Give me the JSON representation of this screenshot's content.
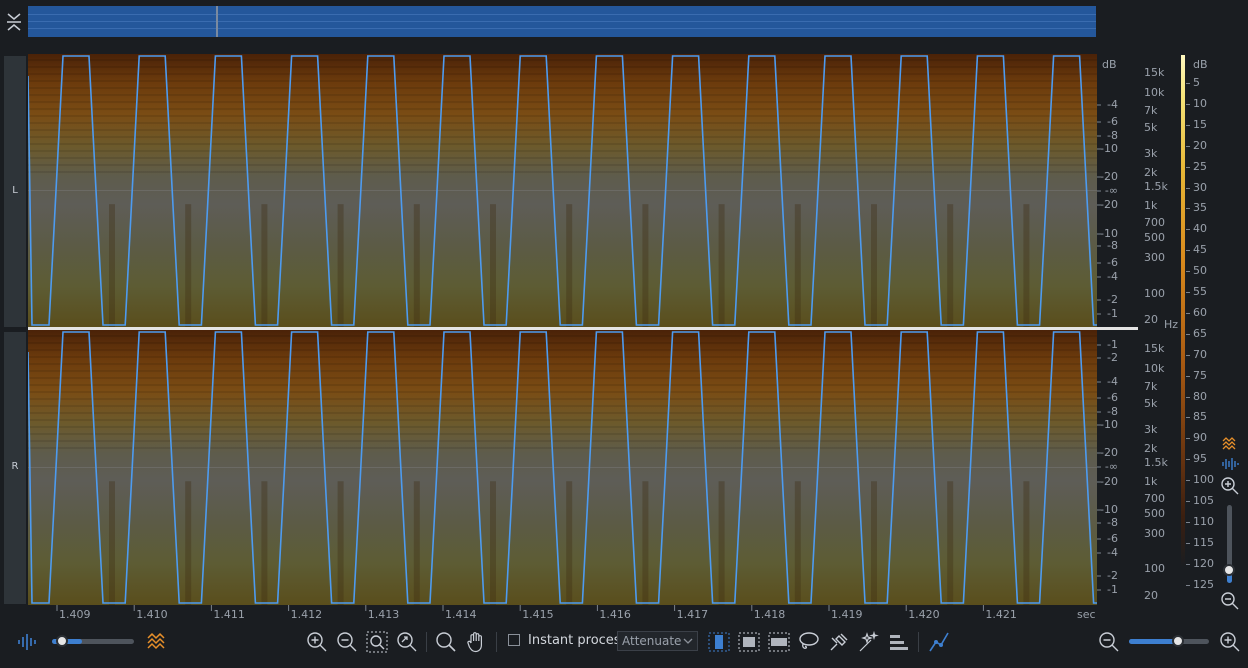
{
  "channels": {
    "left_label": "L",
    "right_label": "R"
  },
  "amplitude_scale": {
    "unit": "dB",
    "left_labels": [
      "-4",
      "-6",
      "-8",
      "-10",
      "-20",
      "-∞",
      "-20",
      "-10",
      "-8",
      "-6",
      "-4",
      "-2",
      "-1"
    ],
    "right_labels": [
      "-1",
      "-2",
      "-4",
      "-6",
      "-8",
      "-10",
      "-20",
      "-∞",
      "-20",
      "-10",
      "-8",
      "-6",
      "-4",
      "-2",
      "-1"
    ]
  },
  "frequency_scale": {
    "unit": "Hz",
    "labels": [
      "15k",
      "10k",
      "7k",
      "5k",
      "3k",
      "2k",
      "1.5k",
      "1k",
      "700",
      "500",
      "300",
      "100",
      "20"
    ]
  },
  "colorbar": {
    "unit": "dB",
    "labels": [
      "5",
      "10",
      "15",
      "20",
      "25",
      "30",
      "35",
      "40",
      "45",
      "50",
      "55",
      "60",
      "65",
      "70",
      "75",
      "80",
      "85",
      "90",
      "95",
      "100",
      "105",
      "110",
      "115",
      "120",
      "125"
    ]
  },
  "time_axis": {
    "labels": [
      "1.409",
      "1.410",
      "1.411",
      "1.412",
      "1.413",
      "1.414",
      "1.415",
      "1.416",
      "1.417",
      "1.418",
      "1.419",
      "1.420",
      "1.421"
    ],
    "unit": "sec"
  },
  "toolbar": {
    "instant_process_label": "Instant process",
    "instant_process_checked": false,
    "mode_selected": "Attenuate",
    "opacity_slider_fraction": 0.3,
    "zoom_slider_fraction": 0.62
  },
  "vertical_zoom_fraction": 0.1,
  "colors": {
    "accent": "#3d7fd0",
    "waveform": "#4d9bf0",
    "spectral_icon": "#e8902a",
    "panel": "#1a1d21"
  }
}
